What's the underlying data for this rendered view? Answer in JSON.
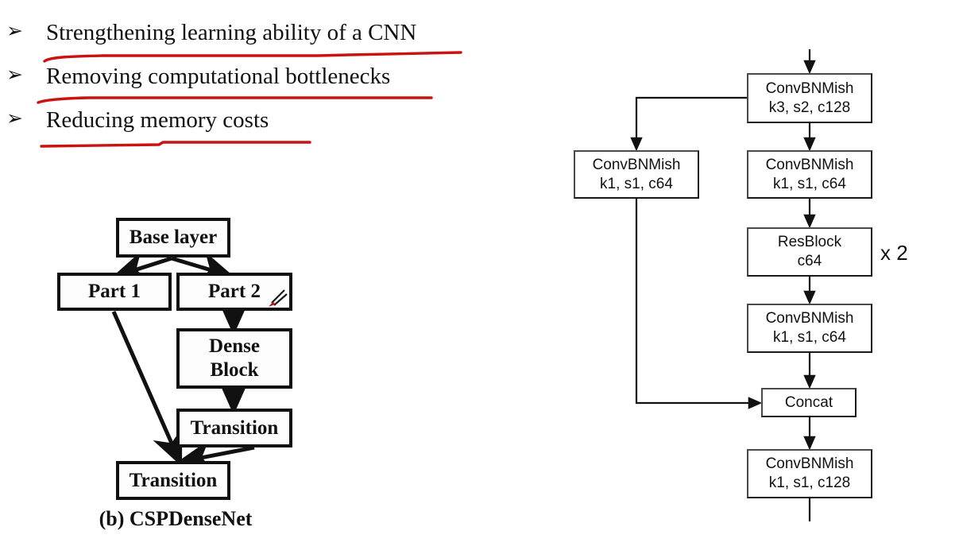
{
  "slide": {
    "background_color": "#ffffff",
    "text_color": "#111111",
    "underline_color": "#cc1111"
  },
  "bullets": {
    "marker_glyph": "➢",
    "items": [
      {
        "label": "Strengthening learning ability of a CNN",
        "underline": true
      },
      {
        "label": "Removing computational bottlenecks",
        "underline": true
      },
      {
        "label": "Reducing memory costs",
        "underline": true
      }
    ]
  },
  "cspdensenet": {
    "caption": "(b) CSPDenseNet",
    "nodes": {
      "base_layer": "Base layer",
      "part1": "Part 1",
      "part2": "Part 2",
      "dense_block_line1": "Dense",
      "dense_block_line2": "Block",
      "transition_top": "Transition",
      "transition_bottom": "Transition"
    },
    "annotation_icon": "pen-mark-icon"
  },
  "cspblock": {
    "repeat_label": "x 2",
    "nodes": {
      "stem": {
        "line1": "ConvBNMish",
        "line2": "k3, s2, c128"
      },
      "left_branch": {
        "line1": "ConvBNMish",
        "line2": "k1, s1, c64"
      },
      "right_branch": {
        "line1": "ConvBNMish",
        "line2": "k1, s1, c64"
      },
      "resblock": {
        "line1": "ResBlock",
        "line2": "c64"
      },
      "post_res": {
        "line1": "ConvBNMish",
        "line2": "k1, s1, c64"
      },
      "concat": {
        "line1": "Concat",
        "line2": ""
      },
      "output": {
        "line1": "ConvBNMish",
        "line2": "k1, s1, c128"
      }
    }
  }
}
